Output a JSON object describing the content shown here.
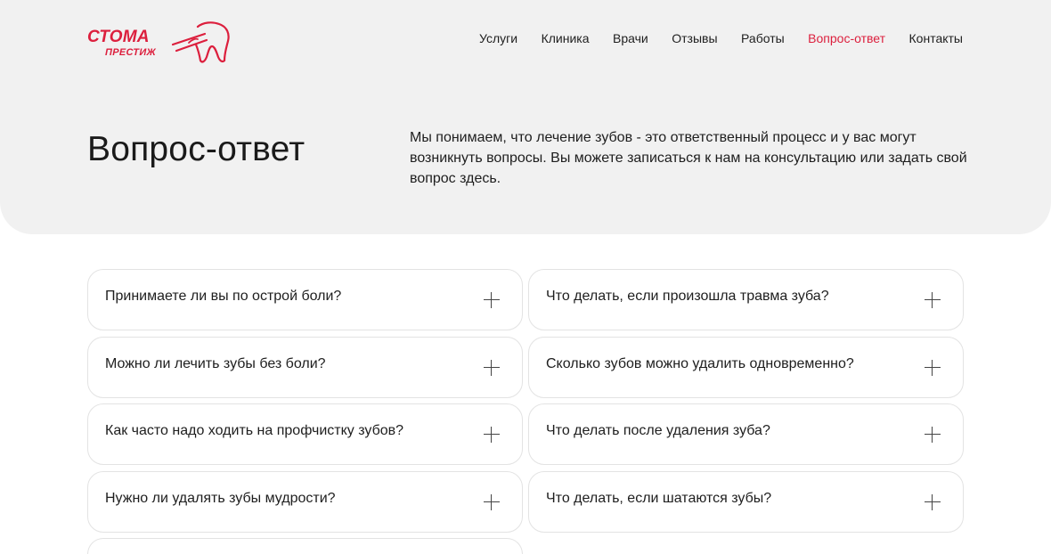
{
  "brand": {
    "name_line1": "СТОМА",
    "name_line2": "ПРЕСТИЖ",
    "logo_icon": "tooth-icon",
    "accent_color": "#dc1f3d"
  },
  "nav": {
    "items": [
      {
        "label": "Услуги"
      },
      {
        "label": "Клиника"
      },
      {
        "label": "Врачи"
      },
      {
        "label": "Отзывы"
      },
      {
        "label": "Работы"
      },
      {
        "label": "Вопрос-ответ",
        "active": true
      },
      {
        "label": "Контакты"
      }
    ]
  },
  "hero": {
    "title": "Вопрос-ответ",
    "intro": "Мы понимаем, что лечение зубов - это ответственный процесс и у вас могут возникнуть вопросы. Вы можете записаться к нам на консультацию или задать свой вопрос здесь."
  },
  "faq": {
    "expand_icon": "plus-icon",
    "items": [
      {
        "question": "Принимаете ли вы по острой боли?"
      },
      {
        "question": "Что делать, если произошла травма зуба?"
      },
      {
        "question": "Можно ли лечить зубы без боли?"
      },
      {
        "question": "Сколько зубов можно удалить одновременно?"
      },
      {
        "question": "Как часто надо ходить на профчистку зубов?"
      },
      {
        "question": "Что делать после удаления зуба?"
      },
      {
        "question": "Нужно ли удалять зубы мудрости?"
      },
      {
        "question": "Что делать, если шатаются зубы?"
      },
      {
        "question": ""
      }
    ]
  }
}
